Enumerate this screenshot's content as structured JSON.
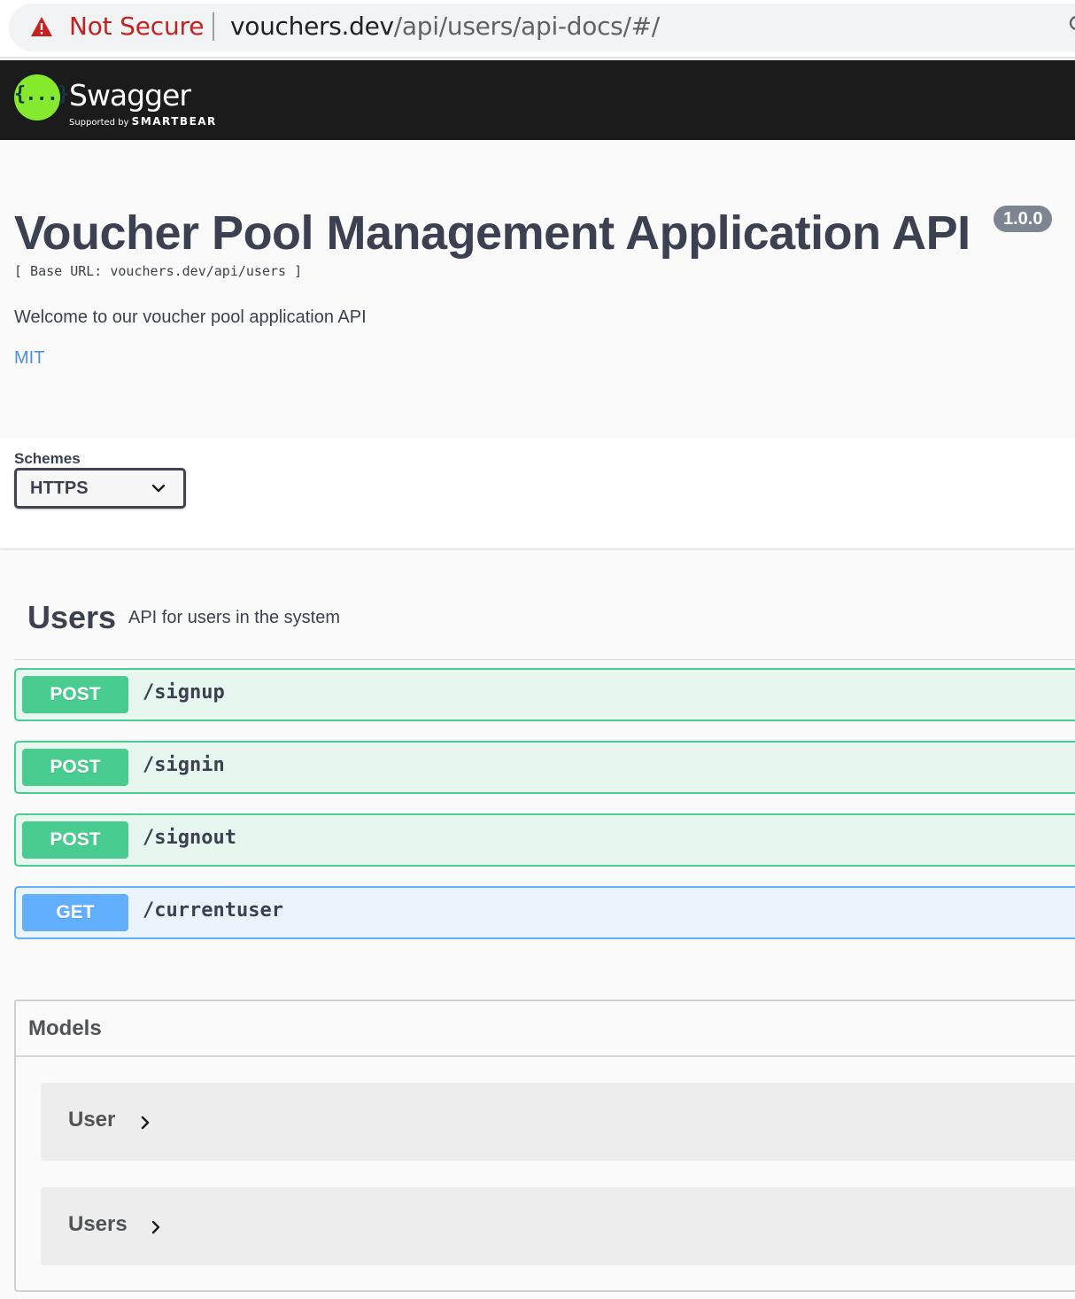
{
  "browser": {
    "security_label": "Not Secure",
    "url_host": "vouchers.dev",
    "url_path": "/api/users/api-docs/#/",
    "icons": {
      "warning": "warning-triangle-icon",
      "search": "search-icon"
    },
    "colors": {
      "warning": "#c5221f"
    }
  },
  "topbar": {
    "logo_glyph": "{...}",
    "brand": "Swagger",
    "supported_by": "Supported by",
    "sponsor": "SMARTBEAR",
    "colors": {
      "background": "#1b1b1b",
      "logo": "#85ea2d"
    }
  },
  "info": {
    "title": "Voucher Pool Management Application API",
    "version": "1.0.0",
    "base_url": "[ Base URL: vouchers.dev/api/users ]",
    "description": "Welcome to our voucher pool application API",
    "license": "MIT"
  },
  "schemes": {
    "label": "Schemes",
    "selected": "HTTPS"
  },
  "tag": {
    "name": "Users",
    "description": "API for users in the system",
    "operations": [
      {
        "method": "POST",
        "path": "/signup"
      },
      {
        "method": "POST",
        "path": "/signin"
      },
      {
        "method": "POST",
        "path": "/signout"
      },
      {
        "method": "GET",
        "path": "/currentuser"
      }
    ]
  },
  "models": {
    "title": "Models",
    "items": [
      {
        "name": "User"
      },
      {
        "name": "Users"
      }
    ]
  },
  "colors": {
    "post": "#49cc90",
    "get": "#61affe",
    "text": "#3b4151",
    "link": "#4990e2"
  }
}
